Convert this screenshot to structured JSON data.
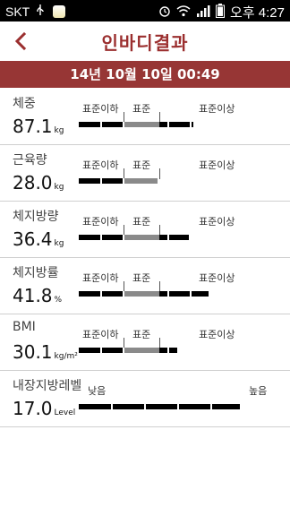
{
  "status": {
    "carrier": "SKT",
    "time": "오후 4:27"
  },
  "header": {
    "title": "인바디결과",
    "date": "14년 10월 10일 00:49"
  },
  "scale_labels": {
    "below": "표준이하",
    "standard": "표준",
    "above": "표준이상",
    "low": "낮음",
    "high": "높음"
  },
  "metrics": [
    {
      "label": "체중",
      "value": "87.1",
      "unit": "kg",
      "level": 0.58
    },
    {
      "label": "근육량",
      "value": "28.0",
      "unit": "kg",
      "level": 0.4
    },
    {
      "label": "체지방량",
      "value": "36.4",
      "unit": "kg",
      "level": 0.56
    },
    {
      "label": "체지방률",
      "value": "41.8",
      "unit": "%",
      "level": 0.66
    },
    {
      "label": "BMI",
      "value": "30.1",
      "unit": "kg/m²",
      "level": 0.5
    },
    {
      "label": "내장지방레벨",
      "value": "17.0",
      "unit": "Level",
      "level": 0.82
    }
  ],
  "colors": {
    "accent": "#973635",
    "title": "#9b2f2f"
  }
}
